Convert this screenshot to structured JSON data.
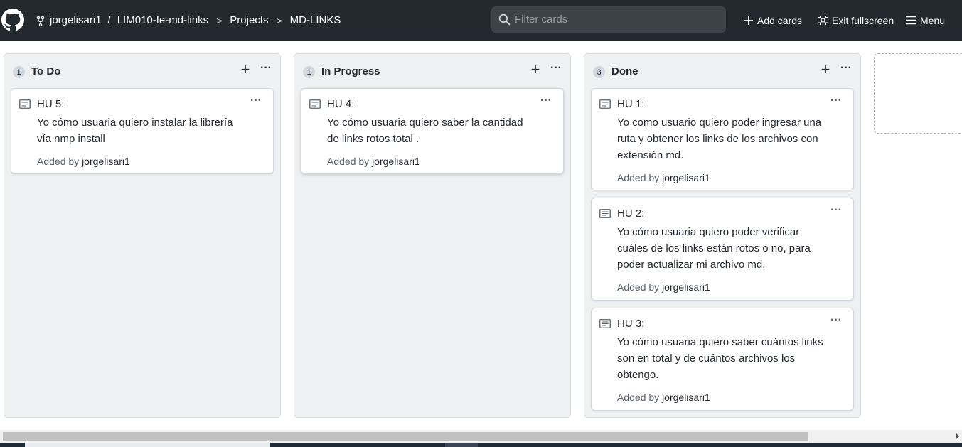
{
  "header": {
    "owner": "jorgelisari1",
    "separator": "/",
    "repo": "LIM010-fe-md-links",
    "projects": "Projects",
    "project_name": "MD-LINKS",
    "chevron": ">",
    "search_placeholder": "Filter cards",
    "add_cards": "Add cards",
    "exit_fullscreen": "Exit fullscreen",
    "menu": "Menu"
  },
  "columns": [
    {
      "count": "1",
      "title": "To Do",
      "cards": [
        {
          "title": "HU 5:",
          "body_lines": [
            "Yo cómo usuaria quiero instalar la librería",
            "vía nmp install"
          ],
          "added_prefix": "Added by",
          "author": "jorgelisari1"
        }
      ]
    },
    {
      "count": "1",
      "title": "In Progress",
      "cards": [
        {
          "title": "HU 4:",
          "body_lines": [
            "Yo cómo usuaria quiero saber la cantidad",
            "de links rotos total ."
          ],
          "added_prefix": "Added by",
          "author": "jorgelisari1"
        }
      ]
    },
    {
      "count": "3",
      "title": "Done",
      "cards": [
        {
          "title": "HU 1:",
          "body_lines": [
            "Yo como usuario quiero poder ingresar una",
            "ruta y obtener los links de los archivos con",
            "extensión md."
          ],
          "added_prefix": "Added by",
          "author": "jorgelisari1"
        },
        {
          "title": "HU 2:",
          "body_lines": [
            "Yo cómo usuaria quiero poder verificar",
            "cuáles de los links están rotos o no, para",
            "poder actualizar mi archivo md."
          ],
          "added_prefix": "Added by",
          "author": "jorgelisari1"
        },
        {
          "title": "HU 3:",
          "body_lines": [
            "Yo cómo usuaria quiero saber cuántos links",
            "son en total y de cuántos archivos los",
            "obtengo."
          ],
          "added_prefix": "Added by",
          "author": "jorgelisari1"
        }
      ]
    }
  ],
  "icons": {
    "logo": "github-logo-icon",
    "repo": "repo-forked-icon",
    "search": "search-icon",
    "plus": "plus-icon",
    "fullscreen": "screen-normal-icon",
    "menu": "hamburger-icon",
    "note": "note-icon",
    "more": "kebab-horizontal-icon"
  },
  "colors": {
    "header_bg": "#24292f",
    "column_bg": "#eff0f2",
    "card_bg": "#ffffff"
  }
}
